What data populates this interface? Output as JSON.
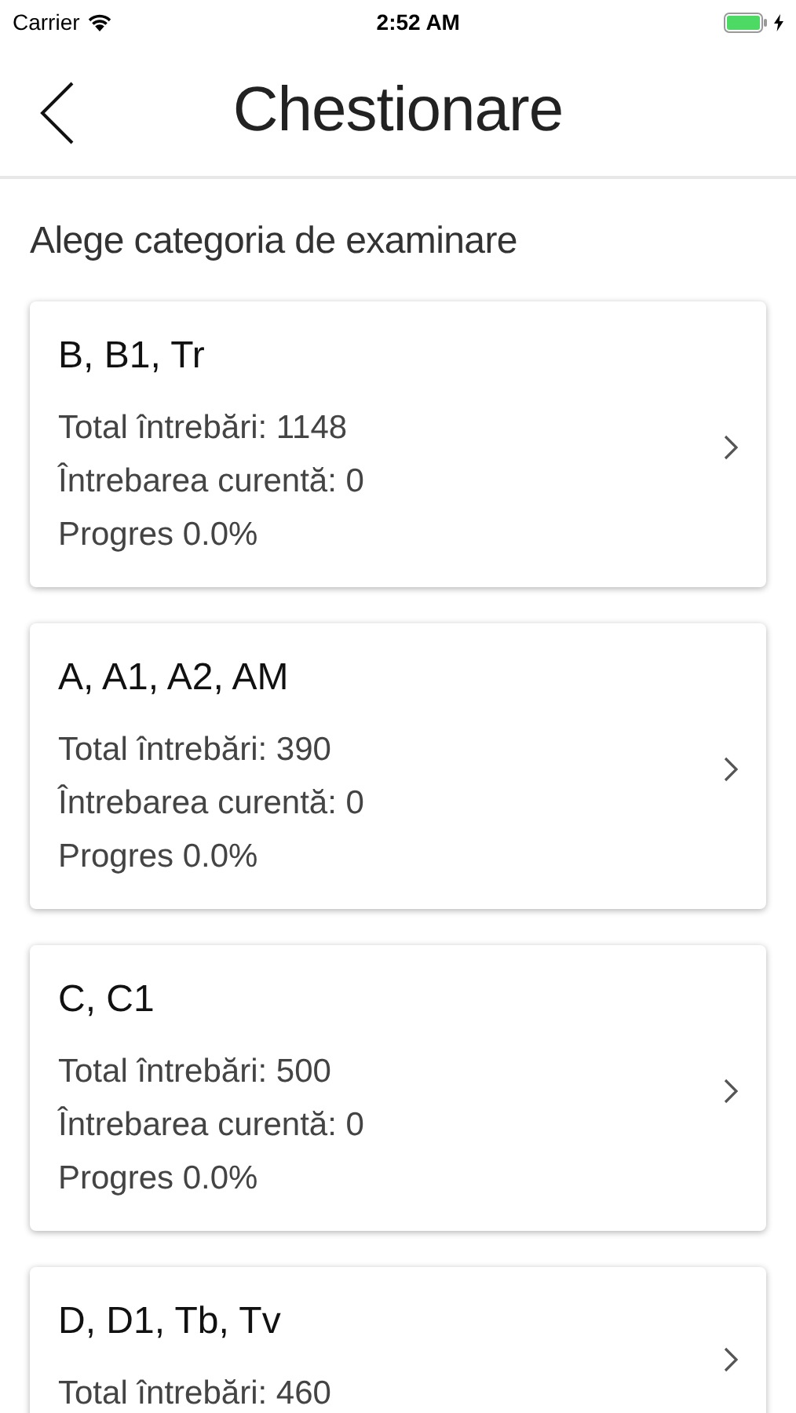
{
  "status_bar": {
    "carrier": "Carrier",
    "time": "2:52 AM",
    "charging": true
  },
  "nav": {
    "title": "Chestionare"
  },
  "subtitle": "Alege categoria de examinare",
  "categories": [
    {
      "title": "B, B1, Tr",
      "lines": [
        "Total întrebări: 1148",
        "Întrebarea curentă: 0",
        "Progres 0.0%"
      ]
    },
    {
      "title": "A, A1, A2, AM",
      "lines": [
        "Total întrebări: 390",
        "Întrebarea curentă: 0",
        "Progres 0.0%"
      ]
    },
    {
      "title": "C, C1",
      "lines": [
        "Total întrebări: 500",
        "Întrebarea curentă: 0",
        "Progres 0.0%"
      ]
    },
    {
      "title": "D, D1, Tb, Tv",
      "lines": [
        "Total întrebări: 460"
      ]
    }
  ]
}
